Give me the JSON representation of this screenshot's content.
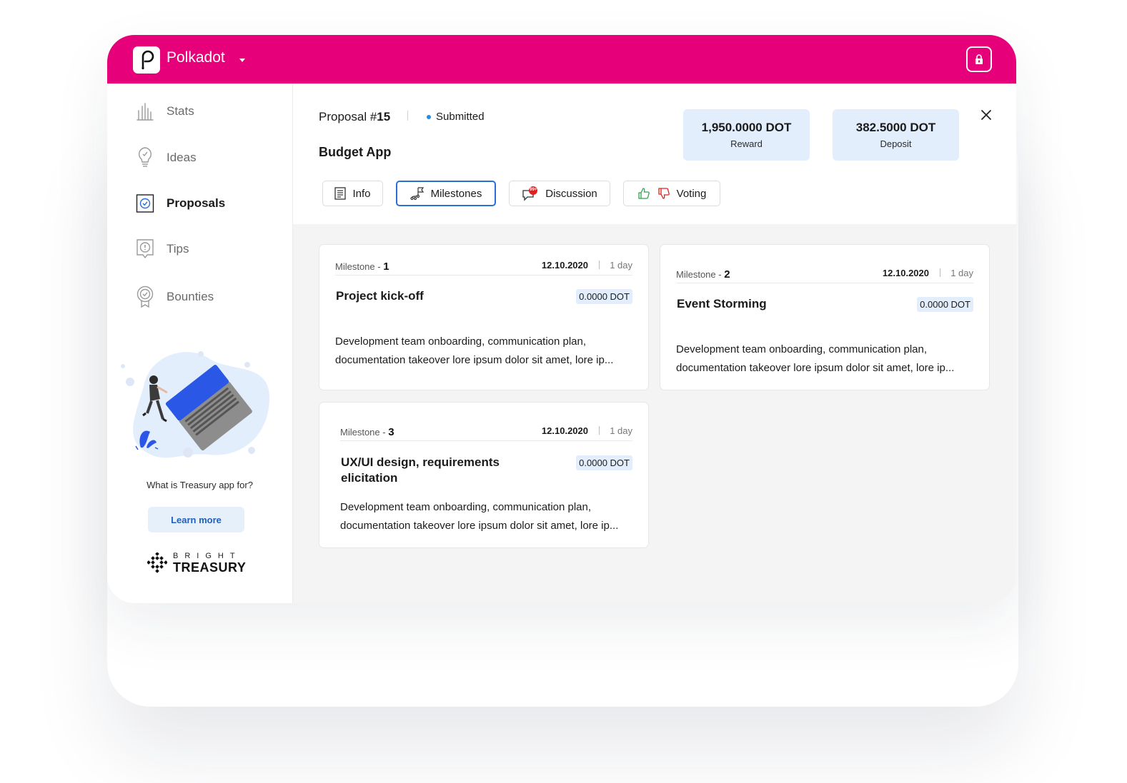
{
  "header": {
    "brand": "Polkadot",
    "logo_letter": "P",
    "brand_color": "#e6007a"
  },
  "sidebar": {
    "items": [
      {
        "label": "Stats",
        "icon": "stats-icon"
      },
      {
        "label": "Ideas",
        "icon": "lightbulb-icon"
      },
      {
        "label": "Proposals",
        "icon": "checkbox-icon"
      },
      {
        "label": "Tips",
        "icon": "tip-icon"
      },
      {
        "label": "Bounties",
        "icon": "badge-icon"
      }
    ],
    "active": "Proposals",
    "promo_question": "What is Treasury app for?",
    "learn_more": "Learn more",
    "footer_logo_top": "BRIGHT",
    "footer_logo_bottom": "TREASURY"
  },
  "proposal": {
    "label": "Proposal #",
    "number": "15",
    "status": "Submitted",
    "title": "Budget App",
    "reward_value": "1,950.0000 DOT",
    "reward_label": "Reward",
    "deposit_value": "382.5000 DOT",
    "deposit_label": "Deposit"
  },
  "tabs": [
    {
      "label": "Info"
    },
    {
      "label": "Milestones"
    },
    {
      "label": "Discussion",
      "badge": "99+"
    },
    {
      "label": "Voting"
    }
  ],
  "active_tab": "Milestones",
  "milestones": [
    {
      "label": "Milestone - ",
      "number": "1",
      "date": "12.10.2020",
      "duration": "1 day",
      "title": "Project  kick-off",
      "amount": "0.0000 DOT",
      "description": "Development team onboarding, communication plan, documentation takeover lore ipsum dolor sit amet, lore ip..."
    },
    {
      "label": "Milestone - ",
      "number": "2",
      "date": "12.10.2020",
      "duration": "1 day",
      "title": "Event Storming",
      "amount": "0.0000 DOT",
      "description": "Development team onboarding, communication plan, documentation takeover lore ipsum dolor sit amet, lore ip..."
    },
    {
      "label": "Milestone - ",
      "number": "3",
      "date": "12.10.2020",
      "duration": "1 day",
      "title": "UX/UI design, requirements elicitation",
      "amount": "0.0000 DOT",
      "description": "Development team onboarding, communication plan, documentation takeover lore ipsum dolor sit amet, lore ip..."
    }
  ]
}
